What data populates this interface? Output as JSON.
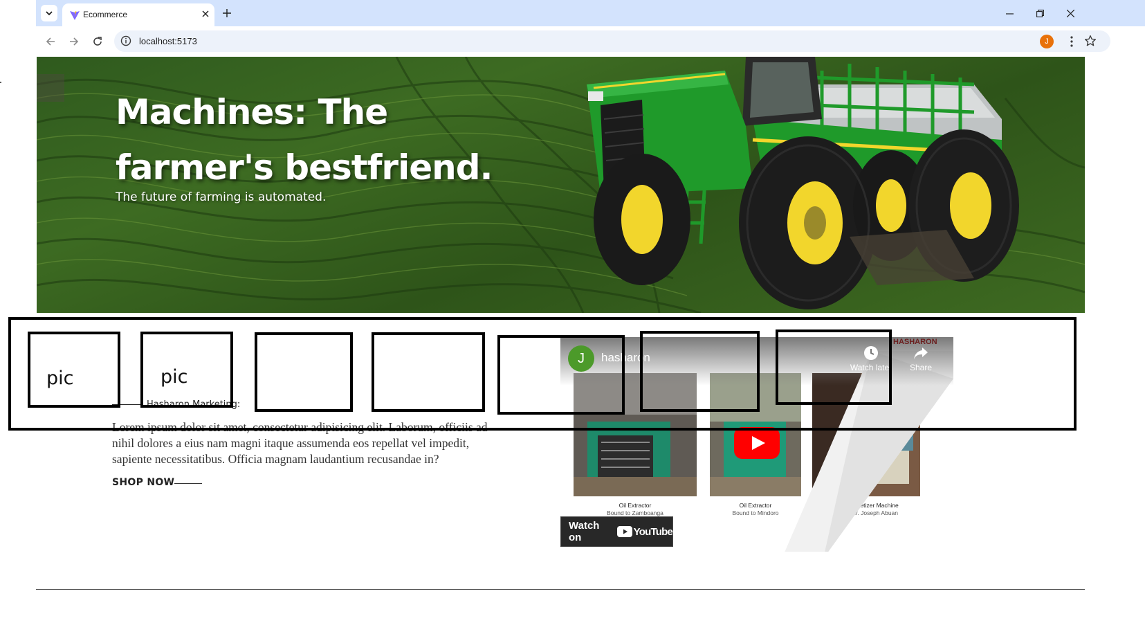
{
  "browser": {
    "tab_title": "Ecommerce",
    "url": "localhost:5173",
    "profile_initial": "J"
  },
  "hero": {
    "title_line1": "Machines: The",
    "title_line2": "farmer's bestfriend.",
    "subtitle": "The future of farming is automated."
  },
  "placeholders": {
    "pic1_label": "pic",
    "pic2_label": "pic"
  },
  "content": {
    "eyebrow": "Hasharon Marketing:",
    "body": "Lorem ipsum dolor sit amet, consectetur adipisicing elit. Laborum, officiis ad nihil dolores a eius nam magni itaque assumenda eos repellat vel impedit, sapiente necessitatibus. Officia magnam laudantium recusandae in?",
    "cta": "SHOP NOW"
  },
  "video": {
    "channel_initial": "J",
    "channel_name": "hasharon",
    "brand": "HASHARON",
    "watch_later": "Watch later",
    "share": "Share",
    "thumbs": [
      {
        "title": "Oil Extractor",
        "subtitle": "Bound to Zamboanga"
      },
      {
        "title": "Oil Extractor",
        "subtitle": "Bound to Mindoro"
      },
      {
        "title": "Pelletizer Machine",
        "subtitle": "Mr. Joseph Abuan"
      }
    ],
    "watch_on_label": "Watch on",
    "youtube_word": "YouTube"
  },
  "colors": {
    "tab_strip": "#d3e3fd",
    "omnibox": "#edf2fa",
    "profile": "#e8710a",
    "youtube_red": "#ff0000",
    "tractor_green": "#1f9a2a",
    "tractor_yellow": "#f2d62c"
  },
  "icons": [
    "tab-list-icon",
    "vite-favicon-icon",
    "close-icon",
    "plus-icon",
    "minimize-icon",
    "restore-icon",
    "window-close-icon",
    "back-icon",
    "forward-icon",
    "reload-icon",
    "site-info-icon",
    "star-icon",
    "kebab-menu-icon",
    "clock-icon",
    "share-arrow-icon",
    "youtube-play-icon"
  ]
}
